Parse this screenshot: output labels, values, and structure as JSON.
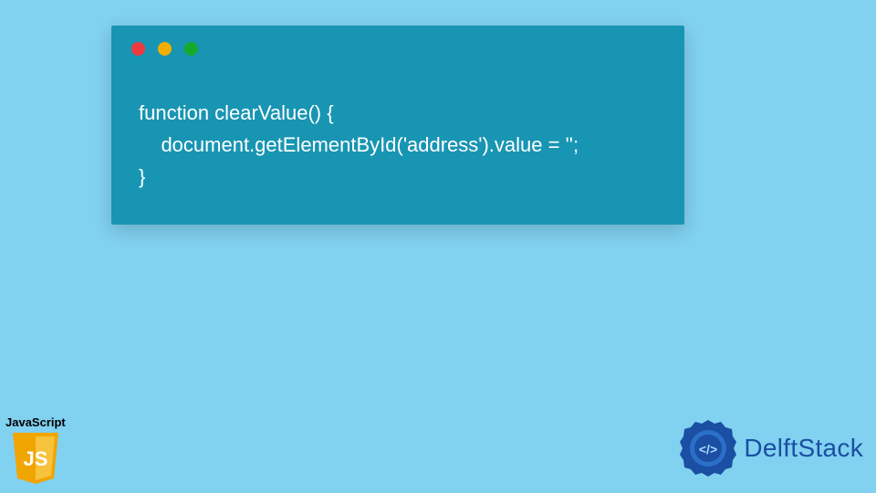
{
  "code": {
    "line1": "function clearValue() {",
    "line2": "    document.getElementById('address').value = '';",
    "line3": "}"
  },
  "badges": {
    "js_label": "JavaScript",
    "js_shield_text": "JS",
    "brand_name": "DelftStack",
    "brand_icon_text": "</>"
  },
  "colors": {
    "page_bg": "#81d1f0",
    "window_bg": "#1895b3",
    "code_text": "#ffffff",
    "shield": "#f1a500",
    "brand": "#1a4fa3"
  }
}
